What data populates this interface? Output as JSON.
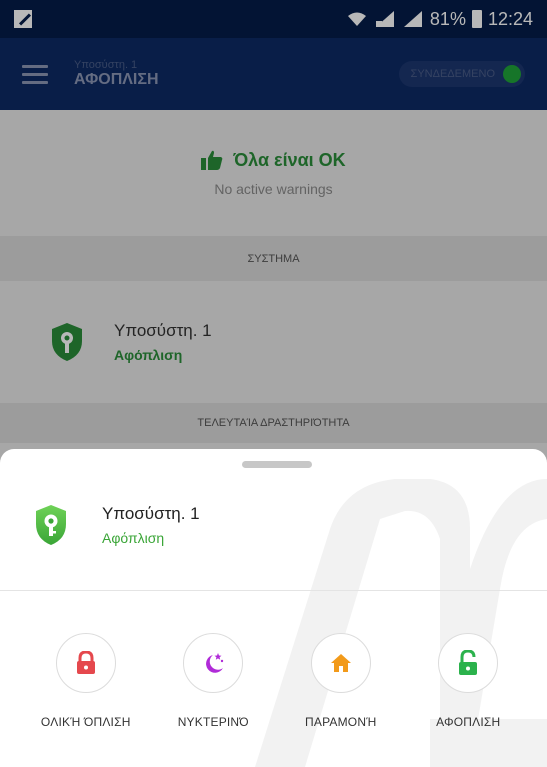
{
  "status_bar": {
    "battery": "81%",
    "time": "12:24"
  },
  "app_bar": {
    "subtitle": "Υποσύστη. 1",
    "title": "ΑΦΟΠΛΙΣΗ",
    "connection_label": "ΣΥΝΔΕΔΕΜΕΝΟ"
  },
  "summary": {
    "headline": "Όλα είναι ΟΚ",
    "subtext": "No active warnings"
  },
  "sections": {
    "system": "ΣΥΣΤΗΜΑ",
    "activity": "ΤΕΛΕΥΤΑΊΑ ΔΡΑΣΤΗΡΙΌΤΗΤΑ"
  },
  "device": {
    "name": "Υποσύστη. 1",
    "state": "Αφόπλιση"
  },
  "sheet": {
    "device_name": "Υποσύστη. 1",
    "device_state": "Αφόπλιση",
    "actions": [
      {
        "label": "ΟΛΙΚΉ ΌΠΛΙΣΗ",
        "icon": "lock-icon",
        "color": "#e5484d"
      },
      {
        "label": "ΝΥΚΤΕΡΙΝΌ",
        "icon": "moon-stars-icon",
        "color": "#b02bd8"
      },
      {
        "label": "ΠΑΡΑΜΟΝΉ",
        "icon": "home-icon",
        "color": "#f29a1a"
      },
      {
        "label": "ΑΦΟΠΛΙΣΗ",
        "icon": "unlock-icon",
        "color": "#2bb24c"
      }
    ]
  },
  "colors": {
    "appbar": "#0d2a64",
    "ok_green": "#2a8d3a",
    "connected_dot": "#1fa33a"
  }
}
